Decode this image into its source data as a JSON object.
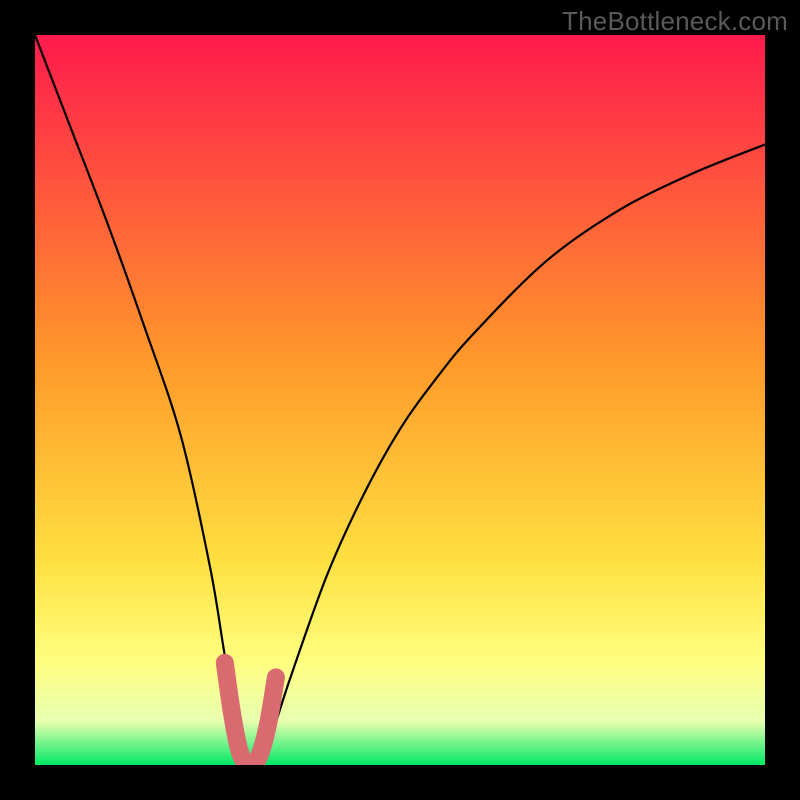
{
  "watermark": "TheBottleneck.com",
  "colors": {
    "frame": "#000000",
    "grad_top": "#ff1a4d",
    "grad_mid": "#ffcc00",
    "grad_ylw": "#ffff66",
    "grad_grn": "#00e865",
    "curve": "#000000",
    "marker": "#d96a6f"
  },
  "chart_data": {
    "type": "line",
    "title": "",
    "xlabel": "",
    "ylabel": "",
    "xlim": [
      0,
      100
    ],
    "ylim": [
      0,
      100
    ],
    "series": [
      {
        "name": "curve",
        "x": [
          0,
          5,
          10,
          15,
          20,
          24,
          26,
          28,
          30,
          32,
          35,
          40,
          45,
          50,
          55,
          60,
          70,
          80,
          90,
          100
        ],
        "y": [
          100,
          87,
          74,
          60,
          45,
          27,
          15,
          4,
          0,
          3,
          12,
          26,
          37,
          46,
          53,
          59,
          69,
          76,
          81,
          85
        ]
      },
      {
        "name": "optimal-marker",
        "x": [
          26,
          27,
          28,
          29,
          30,
          31,
          32,
          33
        ],
        "y": [
          14,
          7,
          2,
          0,
          0,
          2,
          6,
          12
        ]
      }
    ]
  }
}
